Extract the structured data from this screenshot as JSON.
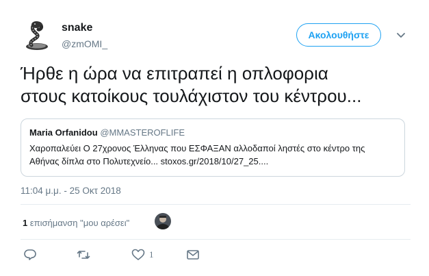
{
  "author": {
    "name": "snake",
    "handle": "@zmOMI_",
    "avatar_icon": "snake-avatar"
  },
  "follow_button": {
    "label": "Ακολουθήστε"
  },
  "menu_icon": "chevron-down-icon",
  "tweet": {
    "lines": [
      "Ήρθε η ώρα να επιτραπεί η οπλοφορια",
      "στους κατοίκους τουλάχιστον του κέντρου..."
    ]
  },
  "quote": {
    "name": "Maria Orfanidou",
    "handle": "@MMASTEROFLIFE",
    "lines": [
      "Χαροπαλεύει Ο 27χρονος Έλληνας που ΕΣΦΑΞΑΝ αλλοδαποί ληστές στο κέντρο της",
      "Αθήνας δίπλα στο Πολυτεχνείο... stoxos.gr/2018/10/27_25...."
    ]
  },
  "timestamp": "11:04 μ.μ. - 25 Οκτ 2018",
  "likes": {
    "count": "1",
    "label": "επισήμανση \"μου αρέσει\""
  },
  "actions": {
    "reply_icon": "reply-icon",
    "retweet_icon": "retweet-icon",
    "like_icon": "heart-icon",
    "like_count": "1",
    "message_icon": "envelope-icon"
  },
  "colors": {
    "accent": "#1da1f2",
    "text": "#14171a",
    "secondary": "#657786",
    "border": "#e6ecf0"
  }
}
